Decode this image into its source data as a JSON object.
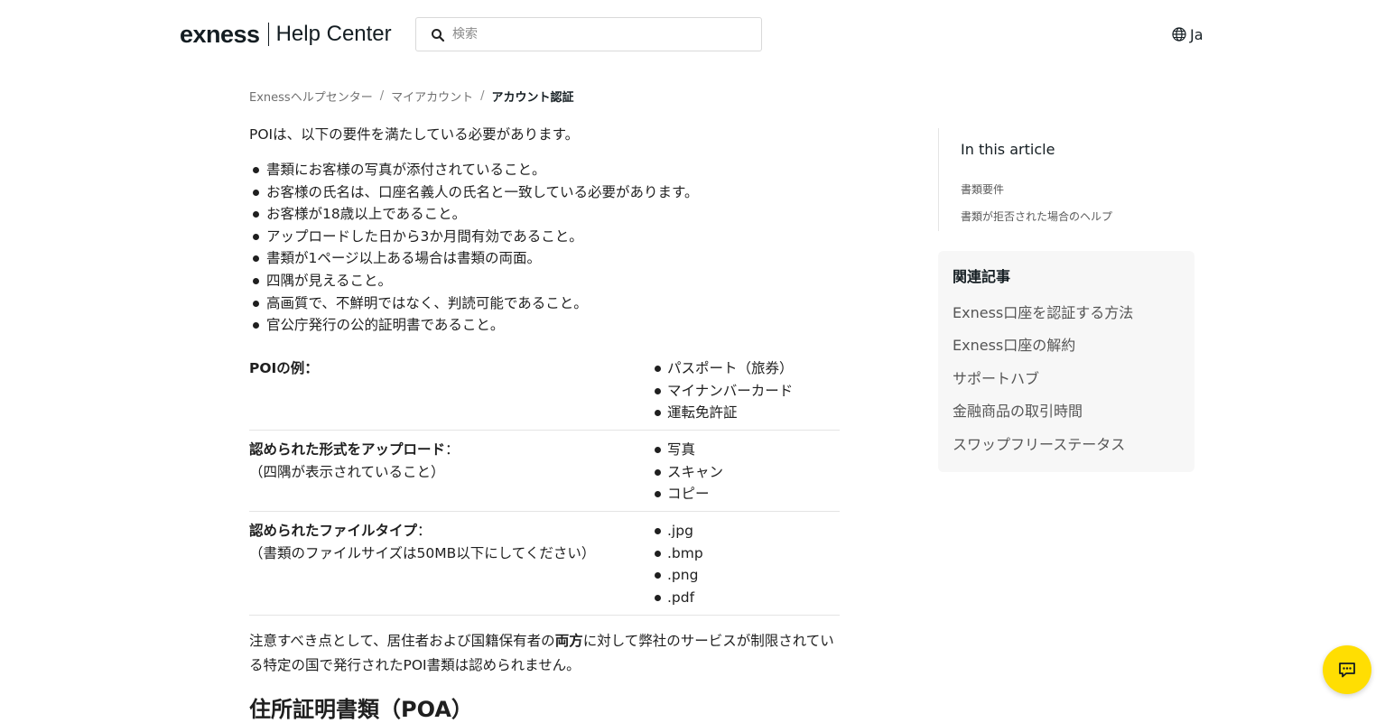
{
  "header": {
    "logo_brand": "exness",
    "logo_sub": "Help Center",
    "search_placeholder": "検索",
    "lang_label": "Ja"
  },
  "breadcrumb": {
    "items": [
      "Exnessヘルプセンター",
      "マイアカウント",
      "アカウント認証"
    ],
    "separator": "/"
  },
  "article": {
    "intro": "POIは、以下の要件を満たしている必要があります。",
    "requirements": [
      "書類にお客様の写真が添付されていること。",
      "お客様の氏名は、口座名義人の氏名と一致している必要があります。",
      "お客様が18歳以上であること。",
      "アップロードした日から3か月間有効であること。",
      "書類が1ページ以上ある場合は書類の両面。",
      "四隅が見えること。",
      "高画質で、不鮮明ではなく、判読可能であること。",
      "官公庁発行の公的証明書であること。"
    ],
    "table": {
      "rows": [
        {
          "label_bold": "POIの例：",
          "label_rest": "",
          "label_note": "",
          "items": [
            "パスポート（旅券）",
            "マイナンバーカード",
            "運転免許証"
          ]
        },
        {
          "label_bold": "認められた形式をアップロード",
          "label_rest": "：",
          "label_note": "（四隅が表示されていること）",
          "items": [
            "写真",
            "スキャン",
            "コピー"
          ]
        },
        {
          "label_bold": "認められたファイルタイプ",
          "label_rest": "：",
          "label_note": "（書類のファイルサイズは50MB以下にしてください）",
          "items": [
            ".jpg",
            ".bmp",
            ".png",
            ".pdf"
          ]
        }
      ]
    },
    "note_part1": "注意すべき点として、居住者および国籍保有者の",
    "note_bold": "両方",
    "note_part2": "に対して弊社のサービスが制限されている特定の国で発行されたPOI書類は認められません。",
    "next_heading": "住所証明書類（POA）"
  },
  "toc": {
    "title": "In this article",
    "links": [
      "書類要件",
      "書類が拒否された場合のヘルプ"
    ]
  },
  "related": {
    "title": "関連記事",
    "links": [
      "Exness口座を認証する方法",
      "Exness口座の解約",
      "サポートハブ",
      "金融商品の取引時間",
      "スワップフリーステータス"
    ]
  },
  "chat": {
    "icon": "chat-icon",
    "color": "#ffde02"
  }
}
